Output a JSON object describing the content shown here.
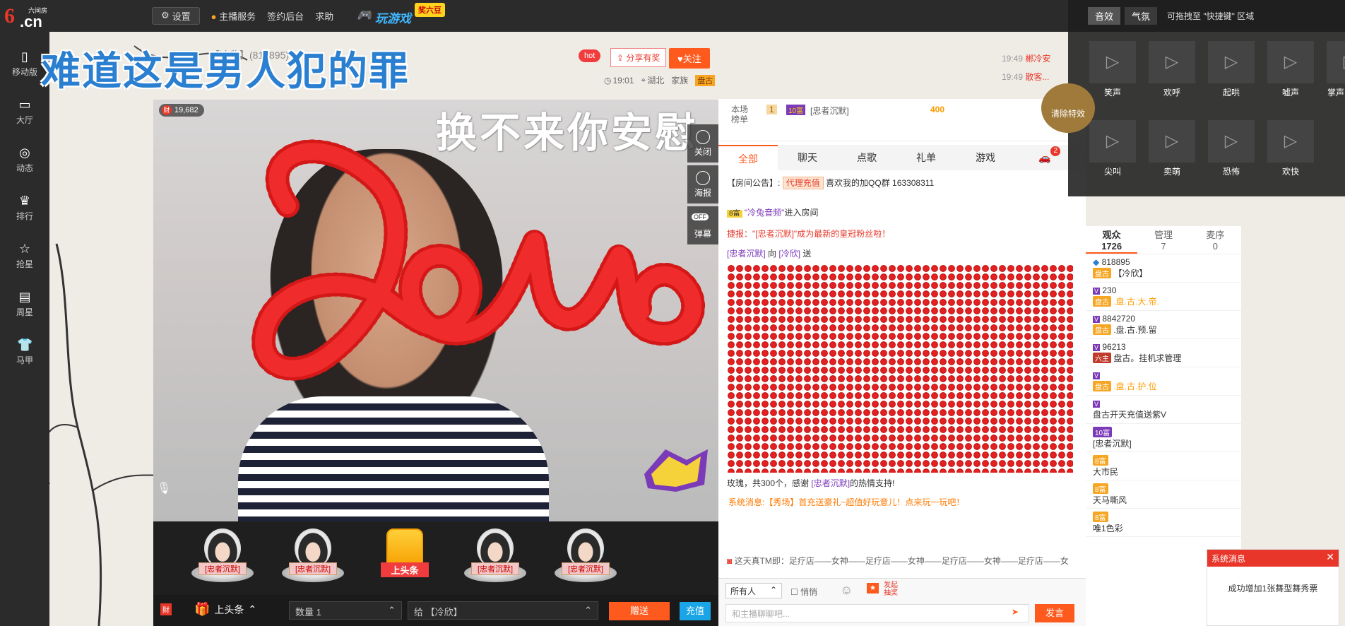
{
  "topbar": {
    "logo_main": "6",
    "logo_suffix": ".cn",
    "logo_sub": "六间房",
    "settings_label": "设置",
    "nav": [
      "主播服务",
      "签约后台",
      "求助"
    ],
    "game_label": "玩游戏",
    "game_badge": "奖六豆"
  },
  "leftrail": [
    {
      "icon": "mobile-icon",
      "label": "移动版"
    },
    {
      "icon": "tv-icon",
      "label": "大厅"
    },
    {
      "icon": "compass-icon",
      "label": "动态"
    },
    {
      "icon": "crown-icon",
      "label": "排行"
    },
    {
      "icon": "star-icon",
      "label": "抢星"
    },
    {
      "icon": "calendar-icon",
      "label": "周星"
    },
    {
      "icon": "shirt-icon",
      "label": "马甲"
    }
  ],
  "song_title": "难道这是男人犯的罪",
  "anchor": {
    "name": "【冷欣】(818895)",
    "hot_label": "hot",
    "share_label": "分享有奖",
    "follow_label": "关注",
    "time": "19:01",
    "location": "湖北",
    "family_label": "家族",
    "family_tag": "盘古"
  },
  "video": {
    "wealth": "19,682",
    "lyric": "换不来你安慰",
    "tools": [
      "关闭",
      "海报",
      "弹幕"
    ],
    "toggle_label": "OFF"
  },
  "rankrow": [
    {
      "label": "[忠者沉默]",
      "gold": false
    },
    {
      "label": "[忠者沉默]",
      "gold": false
    },
    {
      "label": "上头条",
      "gold": true
    },
    {
      "label": "[忠者沉默]",
      "gold": false
    },
    {
      "label": "[忠者沉默]",
      "gold": false
    }
  ],
  "giftbar": {
    "headline_label": "上头条",
    "qty_label": "数量",
    "qty_value": "1",
    "to_label": "给",
    "to_value": "【冷欣】",
    "send_label": "赠送",
    "recharge_label": "充值"
  },
  "chat": {
    "stat_label1": "本场",
    "stat_label2": "榜单",
    "stat_rank": "1",
    "stat_user": "[忠者沉默]",
    "stat_value": "400",
    "tabs": [
      "全部",
      "聊天",
      "点歌",
      "礼单",
      "游戏"
    ],
    "car_count": "2",
    "notice_label": "【房间公告】:",
    "notice_tag": "代理充值",
    "notice_text": "喜欢我的加QQ群 163308311",
    "enter_user": "\"冷兔音频\"",
    "enter_text": "进入房间",
    "fan_text": "捷报：\"[忠者沉默]\"成为最新的皇冠粉丝啦！",
    "gift_from": "[忠者沉默]",
    "gift_to": "[冷欣]",
    "gift_verb": "向",
    "gift_send": "送",
    "thanks_text": "玫瑰，共300个，感谢",
    "thanks_user": "[忠者沉默]",
    "thanks_end": "的热情支持!",
    "sys_msg": "系统消息:【秀场】首充送豪礼~超值好玩意儿！点来玩一玩吧！",
    "marquee": "这天真TM即：足疗店——女神——足疗店——女神——足疗店——女神——足疗店——女",
    "target": "所有人",
    "whisper": "悄悄",
    "lottery": "发起抽奖",
    "input_placeholder": "和主播聊聊吧...",
    "say_label": "发言"
  },
  "audience": {
    "tabs": [
      {
        "label": "观众",
        "count": "1726"
      },
      {
        "label": "管理",
        "count": "7"
      },
      {
        "label": "麦序",
        "count": "0"
      }
    ],
    "items": [
      {
        "id": "818895",
        "tag": "盘古",
        "name": "【冷欣】",
        "gold": false
      },
      {
        "id": "230",
        "tag": "盘古",
        "name": ".盘.古.大.帝.",
        "gold": true
      },
      {
        "id": "8842720",
        "tag": "盘古",
        "name": ".盘.古.预.留",
        "gold": false
      },
      {
        "id": "96213",
        "tag": "六主",
        "name": "盘古。挂机求管理",
        "gold": false
      },
      {
        "id": "",
        "tag": "盘古",
        "name": ".盘.古.护.位",
        "gold": true
      },
      {
        "id": "",
        "tag": "",
        "name": "盘古开天充值送紫V",
        "gold": false
      },
      {
        "id": "",
        "tag": "10富",
        "name": "[忠者沉默]",
        "gold": false
      },
      {
        "id": "",
        "tag": "8富",
        "name": "大市民",
        "gold": false
      },
      {
        "id": "",
        "tag": "8富",
        "name": "天马嘶风",
        "gold": false
      },
      {
        "id": "",
        "tag": "8富",
        "name": "唯1色彩",
        "gold": false
      }
    ]
  },
  "sound": {
    "tabs": [
      "音效",
      "气氛"
    ],
    "hint": "可拖拽至 \"快捷键\" 区域",
    "items": [
      "笑声",
      "欢呼",
      "起哄",
      "嘘声",
      "掌声",
      "尖叫",
      "卖萌",
      "恐怖",
      "欢快"
    ],
    "clear_label": "清除特效"
  },
  "right_chat": [
    {
      "time": "19:49",
      "text": "郴冷安"
    },
    {
      "time": "19:49",
      "text": "散客..."
    }
  ],
  "sysmsg": {
    "title": "系统消息",
    "body": "成功增加1张舞型舞秀票"
  }
}
